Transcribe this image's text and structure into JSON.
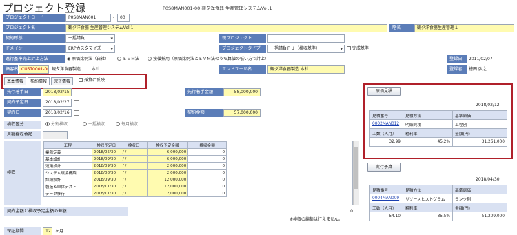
{
  "header": {
    "title": "プロジェクト登録",
    "crumb": "P0S8MAN001-00 親夕洋食器 生産管理システムVol.1"
  },
  "form": {
    "project_code_label": "プロジェクトコード",
    "project_code_value": "P0S8MAN001",
    "project_code_suffix": "00",
    "project_name_label": "プロジェクト名",
    "project_name_value": "観夕洋食器 生産管理システムVol.1",
    "short_name_label": "略名",
    "short_name_value": "観夕洋食器生産管理１",
    "contract_type_label": "契約形態",
    "contract_type_value": "一括請負",
    "parent_project_label": "親プロジェクト",
    "parent_project_value": "",
    "domain_label": "ドメイン",
    "domain_value": "ERPカスタマイズ",
    "project_type_label": "プロジェクトタイプ",
    "project_type_value": "一括請負ＰＪ（検収基準）",
    "project_type_extra": "完成基準",
    "revenue_method_label": "進行基準売上計上方法",
    "revenue_options": [
      "◉ 原価比例法（自社）",
      "ＥＶＭ法",
      "按循採用（原価比例法とＥＶＭ法のうち算値の低い方で計上）"
    ],
    "revenue_selected_index": 0,
    "registered_date_label": "登録日",
    "registered_date_value": "2011/02/07",
    "customer_label": "顧客名",
    "customer_code": "CUST0001-00",
    "customer_name": "観夕洋食器製造",
    "customer_branch": "本社",
    "end_user_label": "エンドユーザ名",
    "end_user_value": "観夕洋食器製造 本社",
    "registrant_label": "登録者",
    "registrant_value": "檜田 弘之"
  },
  "tabs": {
    "items": [
      "基本情報",
      "契約情報",
      "完了情報"
    ],
    "active_index": 1,
    "checkbox_label": "採算に反映"
  },
  "contract": {
    "prestart_label": "先行着手日",
    "prestart_value": "2018/02/15",
    "prestart_amount_label": "先行着手金額",
    "prestart_amount_value": "58,000,000",
    "planned_date_label": "契約予定日",
    "planned_date_value": "2018/02/27",
    "contract_date_label": "契約日",
    "contract_date_value": "2018/02/16",
    "contract_amount_label": "契約金額",
    "contract_amount_value": "57,000,000",
    "acceptance_label": "検収区分",
    "acceptance_options": [
      "分割検収",
      "一括検収",
      "毎月検収"
    ],
    "monthly_label": "月額検収金額",
    "grid_side_label": "検収",
    "grid_headers": [
      "工程",
      "検収予定日",
      "検収日",
      "検収予定金額",
      "検収金額"
    ],
    "grid_rows": [
      {
        "phase": "業務定義",
        "planned": "2018/05/30",
        "actual": "/ /",
        "planned_amount": "6,000,000",
        "amount": "0"
      },
      {
        "phase": "基本設計",
        "planned": "2018/09/30",
        "actual": "/ /",
        "planned_amount": "6,000,000",
        "amount": "0"
      },
      {
        "phase": "運用設計",
        "planned": "2018/09/30",
        "actual": "/ /",
        "planned_amount": "2,000,000",
        "amount": "0"
      },
      {
        "phase": "システム環境構築",
        "planned": "2018/08/30",
        "actual": "/ /",
        "planned_amount": "2,000,000",
        "amount": "0"
      },
      {
        "phase": "詳細設計",
        "planned": "2018/09/30",
        "actual": "/ /",
        "planned_amount": "12,000,000",
        "amount": "0"
      },
      {
        "phase": "製造＆単体テスト",
        "planned": "2018/11/30",
        "actual": "/ /",
        "planned_amount": "12,000,000",
        "amount": "0"
      },
      {
        "phase": "データ移行",
        "planned": "2018/11/30",
        "actual": "/ /",
        "planned_amount": "2,000,000",
        "amount": "0"
      }
    ],
    "diff_label": "契約金額と検収予定金額の差額",
    "diff_value": "0",
    "note": "※検収の編集は行えません。",
    "warranty_label": "保証期間",
    "warranty_value": "12",
    "warranty_unit": "ヶ月"
  },
  "cost_estimate": {
    "button_label": "原価見積",
    "date": "2018/02/12",
    "headers": [
      "見積番号",
      "見積方法",
      "基準原価"
    ],
    "row": [
      "0002MAN012",
      "明細見積",
      "工程別"
    ],
    "headers2": [
      "工数（人月）",
      "粗利率",
      "金額(円)"
    ],
    "row2": [
      "32.99",
      "45.2%",
      "31,261,000"
    ]
  },
  "execution_budget": {
    "button_label": "実行予算",
    "date": "2018/04/30",
    "headers": [
      "見積番号",
      "見積方法",
      "基準原価"
    ],
    "row": [
      "0004MAN009",
      "リソースヒストグラム",
      "ランク別"
    ],
    "headers2": [
      "工数（人月）",
      "粗利率",
      "金額(円)"
    ],
    "row2": [
      "54.10",
      "35.5%",
      "51,209,000"
    ]
  },
  "colors": {
    "label_blue": "#5b7db8",
    "highlight_red": "#b0202a",
    "input_yellow": "#fffbb0"
  }
}
